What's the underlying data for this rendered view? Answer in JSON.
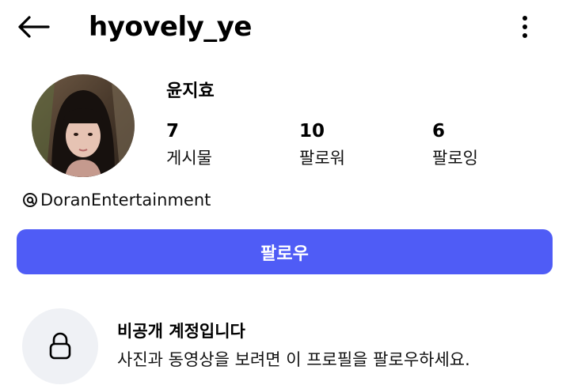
{
  "header": {
    "username": "hyovely_ye",
    "back_icon": "arrow-left-icon",
    "more_icon": "vertical-ellipsis-icon"
  },
  "profile": {
    "display_name": "윤지효",
    "avatar": "profile-photo",
    "stats": {
      "posts": {
        "value": "7",
        "label": "게시물"
      },
      "followers": {
        "value": "10",
        "label": "팔로워"
      },
      "following": {
        "value": "6",
        "label": "팔로잉"
      }
    },
    "threads_handle": "DoranEntertainment",
    "threads_icon": "threads-icon"
  },
  "follow_button": {
    "label": "팔로우",
    "color": "#4f5cf6"
  },
  "private_notice": {
    "icon": "lock-icon",
    "title": "비공개 계정입니다",
    "description": "사진과 동영상을 보려면 이 프로필을 팔로우하세요."
  }
}
